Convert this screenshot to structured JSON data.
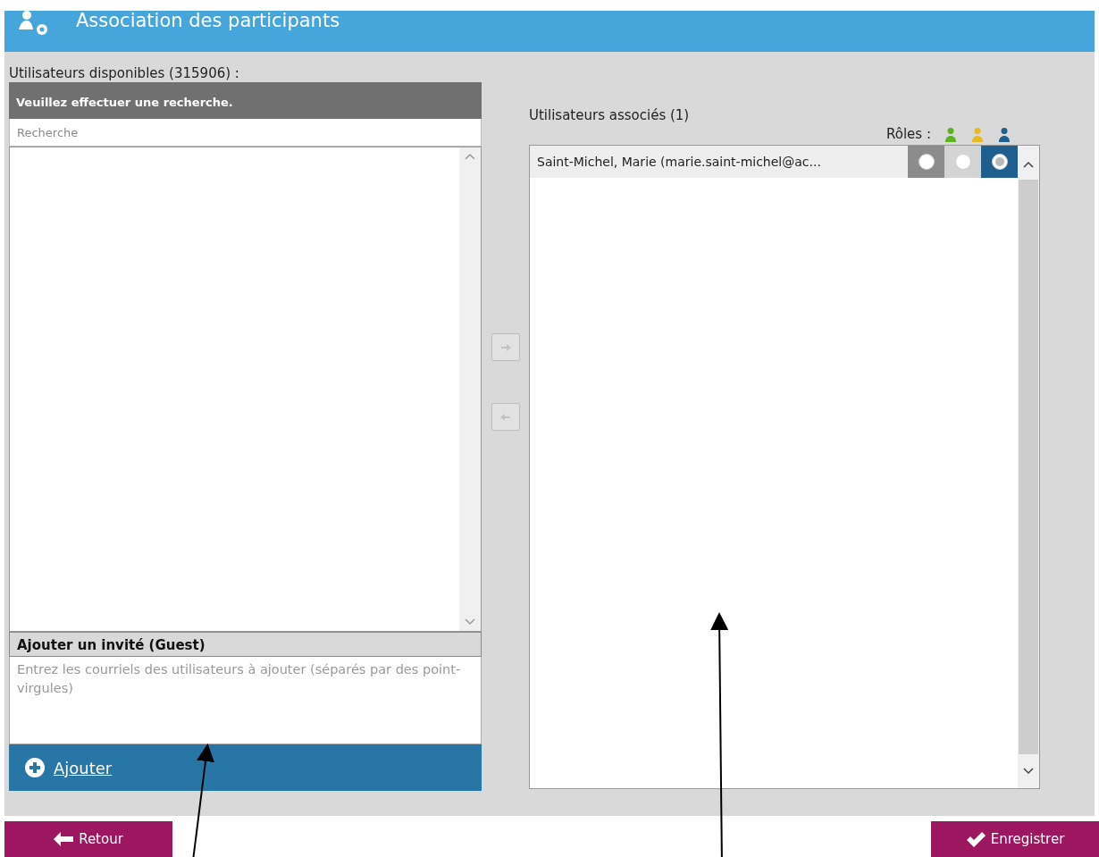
{
  "header": {
    "title": "Association des participants"
  },
  "available": {
    "label": "Utilisateurs disponibles (315906) :",
    "message": "Veuillez effectuer une recherche.",
    "search": {
      "placeholder": "Recherche"
    }
  },
  "guest": {
    "title": "Ajouter un invité (Guest)",
    "placeholder": "Entrez les courriels des utilisateurs à ajouter (séparés par des point-virgules)",
    "add_link": "Ajouter"
  },
  "transfer_buttons": [
    {
      "kind": "right",
      "disabled": true
    },
    {
      "kind": "left",
      "disabled": true
    }
  ],
  "associated": {
    "label": "Utilisateurs associés (1)",
    "roles_label": "Rôles :",
    "roles": [
      {
        "color": "#5cb31e"
      },
      {
        "color": "#e8b922"
      },
      {
        "color": "#1f5f8f"
      }
    ],
    "rows": [
      {
        "name": "Saint-Michel, Marie (marie.saint-michel@ac...",
        "roles": [
          {
            "selected": false,
            "hovered": true
          },
          {
            "selected": false,
            "hovered": false
          },
          {
            "selected": true,
            "hovered": false
          }
        ]
      }
    ]
  },
  "footer": {
    "buttons": [
      {
        "kind": "back",
        "label": "Retour"
      },
      {
        "kind": "save",
        "label": "Enregistrer"
      }
    ]
  }
}
